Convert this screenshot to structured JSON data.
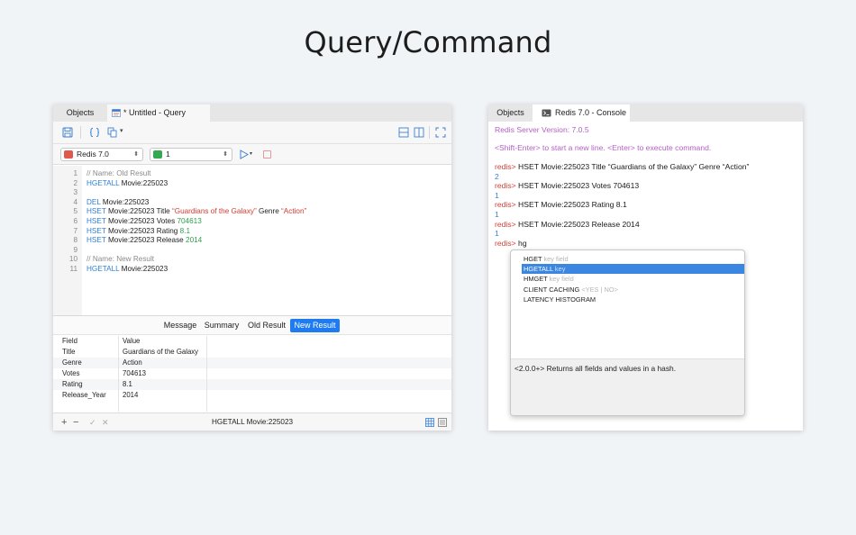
{
  "page_title": "Query/Command",
  "query_window": {
    "tabs": {
      "objects": "Objects",
      "query": "* Untitled - Query"
    },
    "connection": "Redis 7.0",
    "database": "1",
    "editor_lines": [
      {
        "n": "1",
        "segments": [
          {
            "t": "// Name: Old Result",
            "c": "c-cm"
          }
        ]
      },
      {
        "n": "2",
        "segments": [
          {
            "t": "HGETALL",
            "c": "c-kw"
          },
          {
            "t": " Movie:225023",
            "c": "c-pl"
          }
        ]
      },
      {
        "n": "3",
        "segments": []
      },
      {
        "n": "4",
        "segments": [
          {
            "t": "DEL",
            "c": "c-kw"
          },
          {
            "t": " Movie:225023",
            "c": "c-pl"
          }
        ]
      },
      {
        "n": "5",
        "segments": [
          {
            "t": "HSET",
            "c": "c-kw"
          },
          {
            "t": " Movie:225023 Title ",
            "c": "c-pl"
          },
          {
            "t": "“Guardians of the Galaxy”",
            "c": "c-str"
          },
          {
            "t": " Genre ",
            "c": "c-pl"
          },
          {
            "t": "“Action”",
            "c": "c-str"
          }
        ]
      },
      {
        "n": "6",
        "segments": [
          {
            "t": "HSET",
            "c": "c-kw"
          },
          {
            "t": " Movie:225023 Votes ",
            "c": "c-pl"
          },
          {
            "t": "704613",
            "c": "c-num"
          }
        ]
      },
      {
        "n": "7",
        "segments": [
          {
            "t": "HSET",
            "c": "c-kw"
          },
          {
            "t": " Movie:225023 Rating ",
            "c": "c-pl"
          },
          {
            "t": "8.1",
            "c": "c-num"
          }
        ]
      },
      {
        "n": "8",
        "segments": [
          {
            "t": "HSET",
            "c": "c-kw"
          },
          {
            "t": " Movie:225023 Release ",
            "c": "c-pl"
          },
          {
            "t": "2014",
            "c": "c-num"
          }
        ]
      },
      {
        "n": "9",
        "segments": []
      },
      {
        "n": "10",
        "segments": [
          {
            "t": "// Name: New Result",
            "c": "c-cm"
          }
        ]
      },
      {
        "n": "11",
        "segments": [
          {
            "t": "HGETALL",
            "c": "c-kw"
          },
          {
            "t": " Movie:225023",
            "c": "c-pl"
          }
        ]
      }
    ],
    "result_tabs": [
      "Message",
      "Summary",
      "Old Result",
      "New Result"
    ],
    "active_result_tab": "New Result",
    "grid": {
      "columns": [
        "Field",
        "Value"
      ],
      "rows": [
        [
          "Title",
          "Guardians of the Galaxy"
        ],
        [
          "Genre",
          "Action"
        ],
        [
          "Votes",
          "704613"
        ],
        [
          "Rating",
          "8.1"
        ],
        [
          "Release_Year",
          "2014"
        ]
      ]
    },
    "status": {
      "add": "+",
      "remove": "−",
      "apply": "✓",
      "discard": "✕",
      "query_text": "HGETALL Movie:225023"
    }
  },
  "console_window": {
    "tabs": {
      "objects": "Objects",
      "console": "Redis 7.0 - Console"
    },
    "server_version": "Redis Server Version: 7.0.5",
    "help_text": "<Shift-Enter> to start a new line. <Enter> to execute command.",
    "prompt": "redis>",
    "history": [
      {
        "cmd": " HSET Movie:225023 Title “Guardians of the Galaxy” Genre “Action”",
        "result": "2"
      },
      {
        "cmd": " HSET Movie:225023 Votes 704613",
        "result": "1"
      },
      {
        "cmd": " HSET Movie:225023 Rating 8.1",
        "result": "1"
      },
      {
        "cmd": " HSET Movie:225023 Release 2014",
        "result": "1"
      }
    ],
    "current_input": " hg",
    "autocomplete": {
      "items": [
        {
          "cmd": "HGET",
          "hint": " key field"
        },
        {
          "cmd": "HGETALL",
          "hint": " key"
        },
        {
          "cmd": "HMGET",
          "hint": " key field"
        },
        {
          "cmd": "CLIENT CACHING",
          "hint": " <YES | NO>"
        },
        {
          "cmd": "LATENCY HISTOGRAM",
          "hint": ""
        }
      ],
      "selected_index": 1,
      "description": "<2.0.0+> Returns all fields and values in a hash."
    }
  },
  "colors": {
    "accent": "#1f7cf0",
    "keyword": "#2e7fd4",
    "string": "#d63a2f",
    "number": "#2fa04b",
    "comment": "#8a8a8a",
    "console_prompt": "#d3413a",
    "console_info": "#b45fc6",
    "console_result": "#3a7fd6"
  }
}
